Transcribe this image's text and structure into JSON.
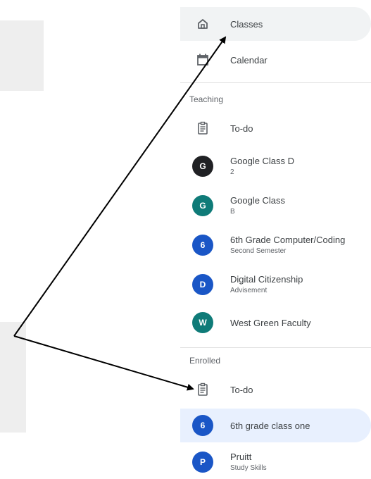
{
  "colors": {
    "active_bg": "#e8f0fe",
    "hover_bg": "#f1f3f4",
    "avatar_black": "#202124",
    "avatar_teal": "#0f7b78",
    "avatar_blue": "#1a56c6"
  },
  "nav": {
    "classes": {
      "label": "Classes",
      "icon": "home-icon"
    },
    "calendar": {
      "label": "Calendar",
      "icon": "calendar-icon"
    }
  },
  "teaching": {
    "header": "Teaching",
    "todo": {
      "label": "To-do",
      "icon": "assignment-icon"
    },
    "classes": [
      {
        "initial": "G",
        "title": "Google Class D",
        "subtitle": "2",
        "color": "#202124"
      },
      {
        "initial": "G",
        "title": "Google Class",
        "subtitle": "B",
        "color": "#0f7b78"
      },
      {
        "initial": "6",
        "title": "6th Grade Computer/Coding",
        "subtitle": "Second Semester",
        "color": "#1a56c6"
      },
      {
        "initial": "D",
        "title": "Digital Citizenship",
        "subtitle": "Advisement",
        "color": "#1a56c6"
      },
      {
        "initial": "W",
        "title": "West Green Faculty",
        "subtitle": "",
        "color": "#0f7b78"
      }
    ]
  },
  "enrolled": {
    "header": "Enrolled",
    "todo": {
      "label": "To-do",
      "icon": "assignment-icon"
    },
    "classes": [
      {
        "initial": "6",
        "title": "6th grade class one",
        "subtitle": "",
        "color": "#1a56c6"
      },
      {
        "initial": "P",
        "title": "Pruitt",
        "subtitle": "Study Skills",
        "color": "#1a56c6"
      }
    ]
  }
}
